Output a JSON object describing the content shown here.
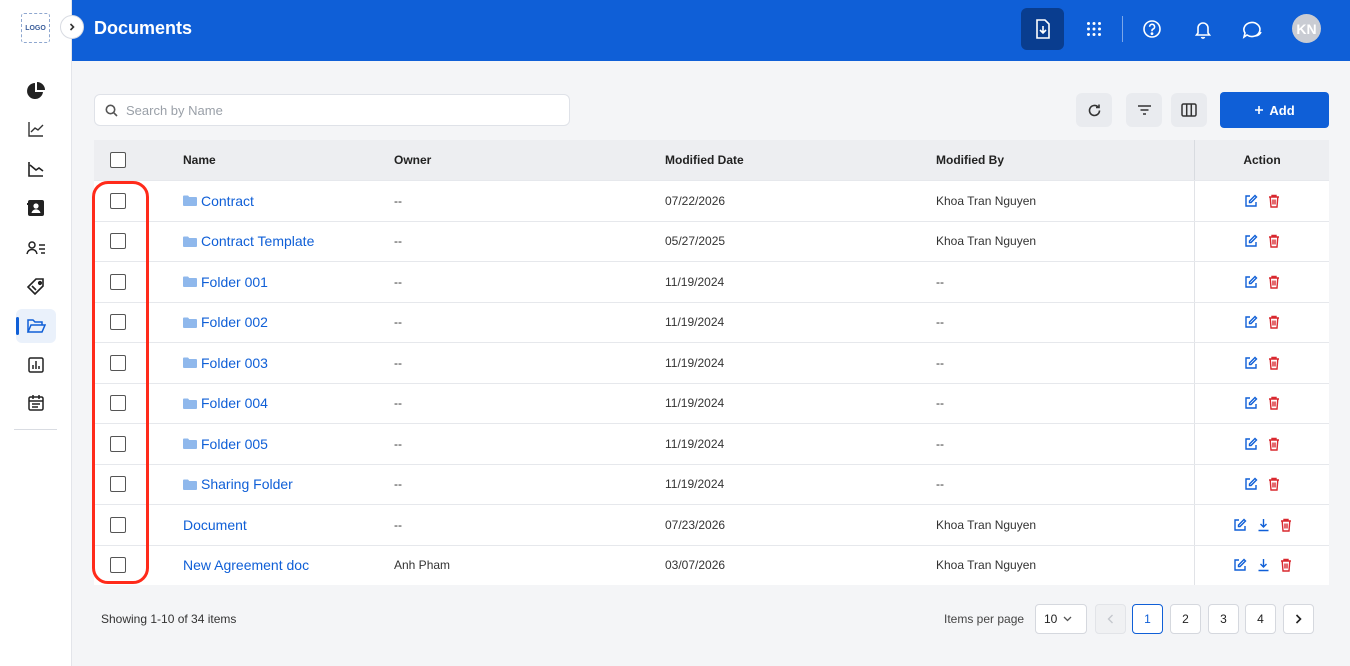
{
  "brand": {
    "logo_text": "LOGO",
    "primary": "#0f5fd7",
    "danger": "#d9282f"
  },
  "header": {
    "title": "Documents",
    "avatar_initials": "KN"
  },
  "sidebar": {
    "items": [
      {
        "icon": "pie-chart-icon"
      },
      {
        "icon": "line-chart-icon"
      },
      {
        "icon": "chart-icon"
      },
      {
        "icon": "contact-card-icon"
      },
      {
        "icon": "user-list-icon"
      },
      {
        "icon": "tag-icon"
      },
      {
        "icon": "folder-open-icon",
        "active": true
      },
      {
        "icon": "bar-chart-icon"
      },
      {
        "icon": "calendar-icon"
      }
    ]
  },
  "toolbar": {
    "search_placeholder": "Search by Name",
    "add_label": "Add"
  },
  "table": {
    "columns": [
      "Name",
      "Owner",
      "Modified Date",
      "Modified By",
      "Action"
    ],
    "rows": [
      {
        "name": "Contract",
        "type": "folder",
        "owner": "--",
        "modified_date": "07/22/2026",
        "modified_by": "Khoa Tran Nguyen"
      },
      {
        "name": "Contract Template",
        "type": "folder",
        "owner": "--",
        "modified_date": "05/27/2025",
        "modified_by": "Khoa Tran Nguyen"
      },
      {
        "name": "Folder 001",
        "type": "folder",
        "owner": "--",
        "modified_date": "11/19/2024",
        "modified_by": "--"
      },
      {
        "name": "Folder 002",
        "type": "folder",
        "owner": "--",
        "modified_date": "11/19/2024",
        "modified_by": "--"
      },
      {
        "name": "Folder 003",
        "type": "folder",
        "owner": "--",
        "modified_date": "11/19/2024",
        "modified_by": "--"
      },
      {
        "name": "Folder 004",
        "type": "folder",
        "owner": "--",
        "modified_date": "11/19/2024",
        "modified_by": "--"
      },
      {
        "name": "Folder 005",
        "type": "folder",
        "owner": "--",
        "modified_date": "11/19/2024",
        "modified_by": "--"
      },
      {
        "name": "Sharing Folder",
        "type": "folder",
        "owner": "--",
        "modified_date": "11/19/2024",
        "modified_by": "--"
      },
      {
        "name": "Document",
        "type": "file",
        "owner": "--",
        "modified_date": "07/23/2026",
        "modified_by": "Khoa Tran Nguyen"
      },
      {
        "name": "New Agreement doc",
        "type": "file",
        "owner": "Anh Pham",
        "modified_date": "03/07/2026",
        "modified_by": "Khoa Tran Nguyen"
      }
    ]
  },
  "footer": {
    "showing": "Showing 1-10 of 34 items",
    "items_per_page_label": "Items per page",
    "items_per_page": "10",
    "pages": [
      "1",
      "2",
      "3",
      "4"
    ],
    "current_page": "1"
  }
}
